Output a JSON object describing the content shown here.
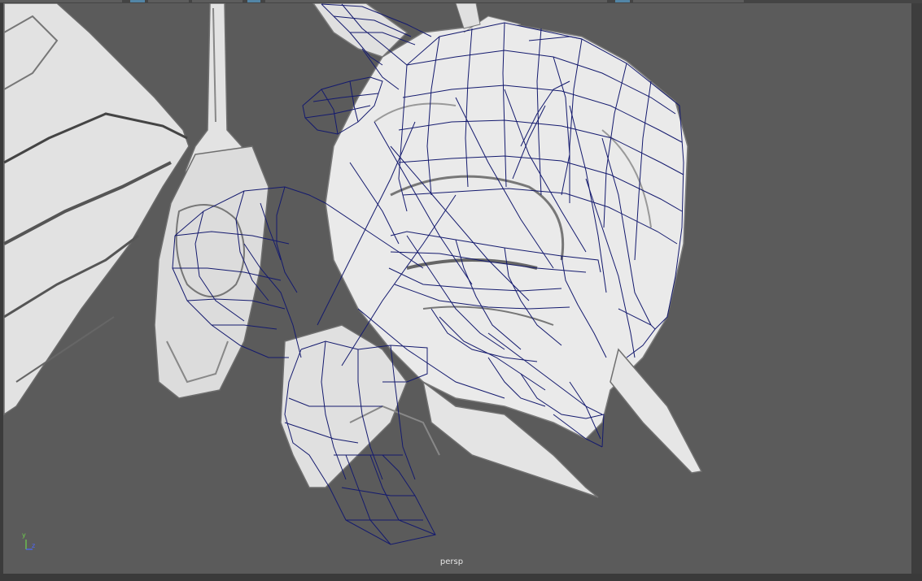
{
  "viewport": {
    "camera_name": "persp",
    "background_color": "#5b5b5b",
    "wireframe_color": "#141a6e",
    "shaded_surface_color": "#e4e4e4"
  },
  "axis_gizmo": {
    "y_label": "y",
    "z_label": "z",
    "y_color": "#6fd24d",
    "z_color": "#4d66ff"
  },
  "toolbar": {
    "accent_color": "#5285a6"
  }
}
